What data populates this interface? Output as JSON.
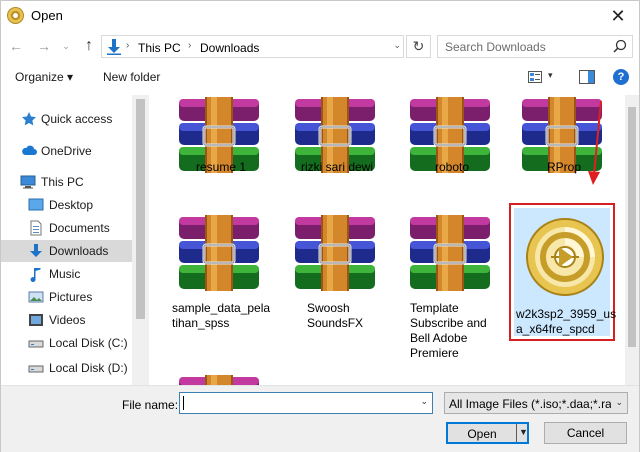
{
  "window": {
    "title": "Open",
    "close_glyph": "✕"
  },
  "nav": {
    "back_glyph": "←",
    "forward_glyph": "→",
    "recent_glyph": "⌄",
    "up_glyph": "↑",
    "breadcrumb": [
      "This PC",
      "Downloads"
    ],
    "separator": "›",
    "dropdown_glyph": "⌄",
    "refresh_glyph": "↻",
    "search_placeholder": "Search Downloads"
  },
  "commandbar": {
    "organize": "Organize ▾",
    "new_folder": "New folder",
    "view_arrow": "▾",
    "help": "?"
  },
  "sidebar": {
    "items": [
      {
        "label": "Quick access",
        "icon": "star-icon"
      },
      {
        "label": "OneDrive",
        "icon": "cloud-icon"
      },
      {
        "label": "This PC",
        "icon": "computer-icon"
      },
      {
        "label": "Desktop",
        "icon": "desktop-icon"
      },
      {
        "label": "Documents",
        "icon": "documents-icon"
      },
      {
        "label": "Downloads",
        "icon": "download-icon",
        "selected": true
      },
      {
        "label": "Music",
        "icon": "music-icon"
      },
      {
        "label": "Pictures",
        "icon": "pictures-icon"
      },
      {
        "label": "Videos",
        "icon": "videos-icon"
      },
      {
        "label": "Local Disk (C:)",
        "icon": "drive-icon"
      },
      {
        "label": "Local Disk (D:)",
        "icon": "drive-icon"
      }
    ]
  },
  "files": [
    {
      "name": "resume 1",
      "icon": "rar-archive-icon"
    },
    {
      "name": "rizki sari dewi",
      "icon": "rar-archive-icon"
    },
    {
      "name": "roboto",
      "icon": "rar-archive-icon"
    },
    {
      "name": "RProp",
      "icon": "rar-archive-icon"
    },
    {
      "name": "sample_data_pela tihan_spss",
      "icon": "rar-archive-icon"
    },
    {
      "name": "Swoosh SoundsFX",
      "icon": "rar-archive-icon"
    },
    {
      "name": "Template Subscribe and Bell Adobe Premiere",
      "icon": "rar-archive-icon"
    },
    {
      "name": "w2k3sp2_3959_us a_x64fre_spcd",
      "icon": "disc-image-icon",
      "selected": true
    },
    {
      "name": "",
      "icon": "rar-archive-icon"
    }
  ],
  "footer": {
    "file_name_label": "File name:",
    "file_name_value": "",
    "file_type": "All Image Files (*.iso;*.daa;*.rar;",
    "open": "Open",
    "cancel": "Cancel",
    "dropdown_glyph": "⌄"
  },
  "colors": {
    "accent": "#0078d7",
    "selection": "#cce8ff",
    "highlight_border": "#d42020",
    "sidebar_selected": "#d9d9d9"
  }
}
